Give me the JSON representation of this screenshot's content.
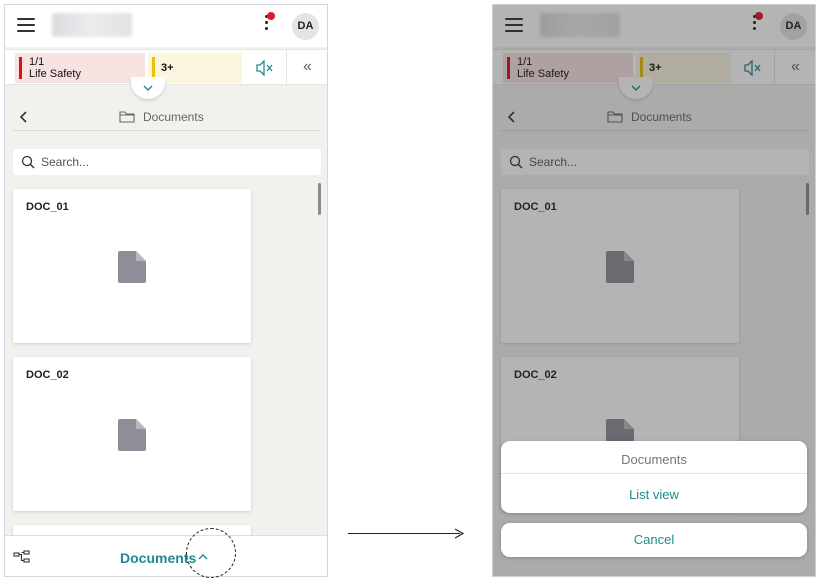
{
  "app": {
    "avatar_initials": "DA",
    "alarms": {
      "life_safety_count": "1/1",
      "life_safety_label": "Life Safety",
      "other_count": "3+"
    },
    "nav": {
      "title": "Documents"
    },
    "search": {
      "placeholder": "Search..."
    },
    "documents": [
      {
        "name": "DOC_01"
      },
      {
        "name": "DOC_02"
      }
    ],
    "bottom_bar": {
      "title": "Documents"
    }
  },
  "action_sheet": {
    "title": "Documents",
    "option": "List view",
    "cancel": "Cancel"
  },
  "colors": {
    "accent": "#1f8a92",
    "life_safety": "#d8101e",
    "warning": "#e8c10c",
    "notification": "#e0152b"
  },
  "icons": [
    "hamburger-icon",
    "kebab-menu-icon",
    "mute-icon",
    "double-chevron-left-icon",
    "chevron-down-icon",
    "chevron-left-icon",
    "folder-icon",
    "search-icon",
    "document-icon",
    "tree-icon",
    "chevron-up-icon",
    "arrow-right-icon"
  ]
}
